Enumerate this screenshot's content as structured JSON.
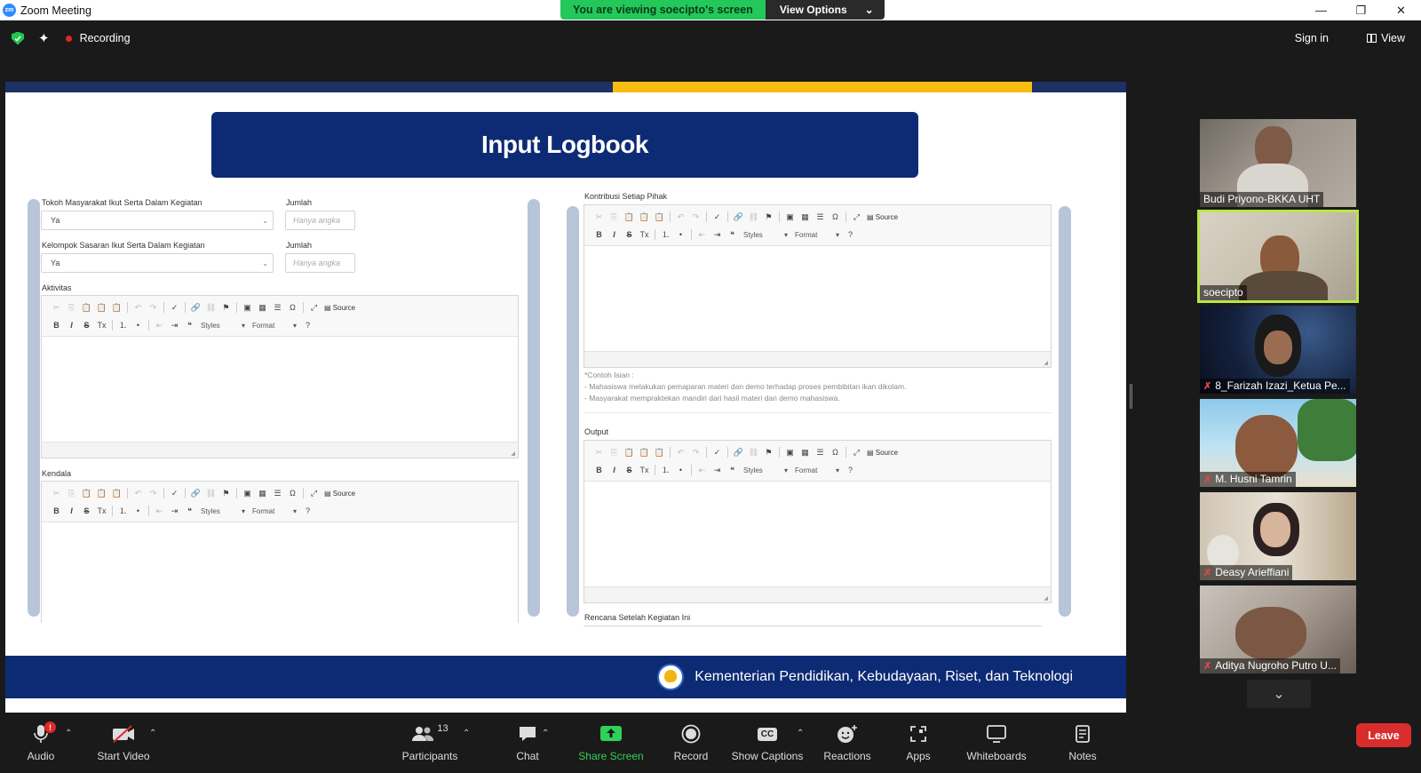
{
  "window": {
    "app_title": "Zoom Meeting",
    "logo_text": "zm",
    "controls": {
      "minimize": "—",
      "restore": "❐",
      "close": "✕"
    }
  },
  "share_banner": {
    "status": "You are viewing soecipto's screen",
    "view_options": "View Options",
    "chevron": "⌄"
  },
  "meeting_top": {
    "recording_label": "Recording",
    "sign_in": "Sign in",
    "view": "View"
  },
  "shared_screen": {
    "page_title": "Input Logbook",
    "left": {
      "tokoh_label": "Tokoh Masyarakat Ikut Serta Dalam Kegiatan",
      "tokoh_value": "Ya",
      "jumlah1_label": "Jumlah",
      "jumlah1_placeholder": "Hanya angka",
      "kelompok_label": "Kelompok Sasaran Ikut Serta Dalam Kegiatan",
      "kelompok_value": "Ya",
      "jumlah2_label": "Jumlah",
      "jumlah2_placeholder": "Hanya angka",
      "aktivitas_label": "Aktivitas",
      "kendala_label": "Kendala"
    },
    "right": {
      "kontribusi_label": "Kontribusi Setiap Pihak",
      "hint_lines": [
        "*Contoh Isian :",
        "- Mahasiswa melakukan pemaparan materi dan demo terhadap proses pembibitan ikan dikolam.",
        "- Masyarakat mempraktekan mandiri dari hasil materi dan demo mahasiswa."
      ],
      "output_label": "Output",
      "rencana_label": "Rencana Setelah Kegiatan Ini"
    },
    "editor_toolbar": {
      "source": "Source",
      "styles": "Styles",
      "format": "Format",
      "help": "?"
    },
    "footer_text": "Kementerian Pendidikan, Kebudayaan, Riset, dan Teknologi"
  },
  "participants_tiles": [
    {
      "name": "Budi Priyono-BKKA UHT",
      "muted": false,
      "active": false
    },
    {
      "name": "soecipto",
      "muted": false,
      "active": true
    },
    {
      "name": "8_Farizah Izazi_Ketua Pe...",
      "muted": true,
      "active": false
    },
    {
      "name": "M. Husni Tamrin",
      "muted": true,
      "active": false
    },
    {
      "name": "Deasy Arieffiani",
      "muted": true,
      "active": false
    },
    {
      "name": "Aditya Nugroho Putro U...",
      "muted": true,
      "active": false
    }
  ],
  "toolbar": {
    "audio": "Audio",
    "audio_badge": "!",
    "start_video": "Start Video",
    "participants": "Participants",
    "participants_count": "13",
    "chat": "Chat",
    "share_screen": "Share Screen",
    "record": "Record",
    "show_captions": "Show Captions",
    "captions_icon": "CC",
    "reactions": "Reactions",
    "apps": "Apps",
    "whiteboards": "Whiteboards",
    "notes": "Notes",
    "leave": "Leave"
  },
  "colors": {
    "share_green": "#24c75a",
    "banner_navy": "#0d2b74",
    "stripe_yellow": "#f9bd12",
    "leave_red": "#d92d2d",
    "active_speaker": "#b9e64a"
  }
}
